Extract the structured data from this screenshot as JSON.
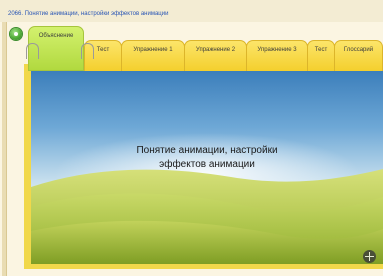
{
  "course": {
    "title": "2066. Понятие анимации, настройки эффектов анимации"
  },
  "nav": {
    "back_icon": "circle-back-icon"
  },
  "tabs": [
    {
      "label": "Объяснение",
      "active": true
    },
    {
      "label": "Тест",
      "active": false
    },
    {
      "label": "Упражнение 1",
      "active": false
    },
    {
      "label": "Упражнение 2",
      "active": false
    },
    {
      "label": "Упражнение 3",
      "active": false
    },
    {
      "label": "Тест",
      "active": false
    },
    {
      "label": "Глоссарий",
      "active": false
    }
  ],
  "slide": {
    "title_line1": "Понятие анимации, настройки",
    "title_line2": "эффектов анимации"
  },
  "controls": {
    "expand_icon": "expand-icon"
  },
  "colors": {
    "active_tab": "#c2e34e",
    "inactive_tab": "#f6d43a",
    "title_text": "#2a56b5"
  }
}
